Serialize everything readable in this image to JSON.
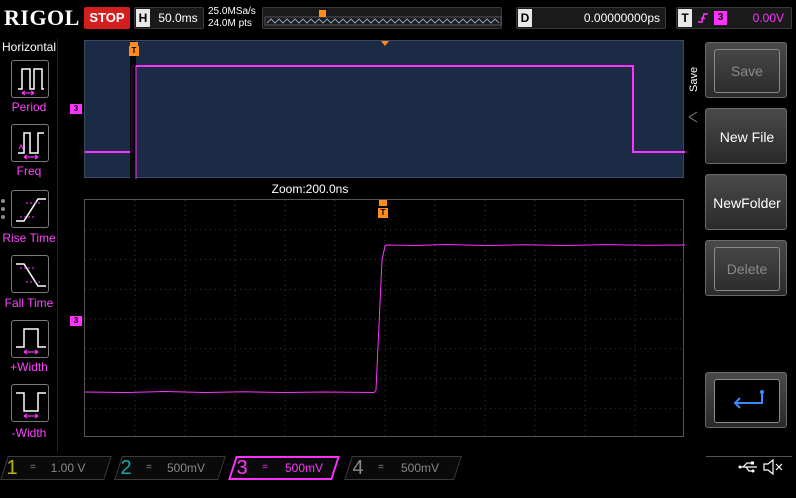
{
  "header": {
    "logo": "RIGOL",
    "run_state": "STOP",
    "timebase_label": "H",
    "timebase_value": "50.0ms",
    "sample_rate": "25.0MSa/s",
    "memory_depth": "24.0M pts",
    "delay_label": "D",
    "delay_value": "0.00000000ps",
    "trigger_label": "T",
    "trigger_source": "3",
    "trigger_level": "0.00V"
  },
  "left_menu": {
    "title": "Horizontal",
    "items": [
      {
        "label": "Period",
        "icon": "period-icon"
      },
      {
        "label": "Freq",
        "icon": "freq-icon"
      },
      {
        "label": "Rise Time",
        "icon": "rise-time-icon"
      },
      {
        "label": "Fall Time",
        "icon": "fall-time-icon"
      },
      {
        "label": "+Width",
        "icon": "positive-width-icon"
      },
      {
        "label": "-Width",
        "icon": "negative-width-icon"
      }
    ]
  },
  "overview": {
    "channel_marker": "3",
    "trigger_marker": "T"
  },
  "zoom": {
    "label": "Zoom:200.0ns"
  },
  "main": {
    "channel_marker": "3",
    "trigger_marker": "T",
    "trigger_level_marker": "T"
  },
  "right_menu": {
    "title": "Save",
    "softkeys": [
      {
        "label": "Save",
        "enabled": false
      },
      {
        "label": "New File",
        "enabled": true
      },
      {
        "label": "NewFolder",
        "enabled": true
      },
      {
        "label": "Delete",
        "enabled": false
      },
      {
        "label": "",
        "icon": "enter-return-icon",
        "enabled": true
      }
    ]
  },
  "channels": [
    {
      "number": "1",
      "coupling": "=",
      "scale": "1.00 V",
      "color": "#b5b51a",
      "active": false
    },
    {
      "number": "2",
      "coupling": "=",
      "scale": "500mV",
      "color": "#1aa5a5",
      "active": false
    },
    {
      "number": "3",
      "coupling": "=",
      "scale": "500mV",
      "color": "#ff33ff",
      "active": true
    },
    {
      "number": "4",
      "coupling": "=",
      "scale": "500mV",
      "color": "#3a6aff",
      "active": false
    }
  ],
  "status_icons": [
    "usb-icon",
    "speaker-muted-icon"
  ],
  "colors": {
    "trace": "#ff33ff",
    "trigger": "#ff8c1a",
    "stop": "#d41f1f",
    "overview_bg": "#1b2a45"
  }
}
